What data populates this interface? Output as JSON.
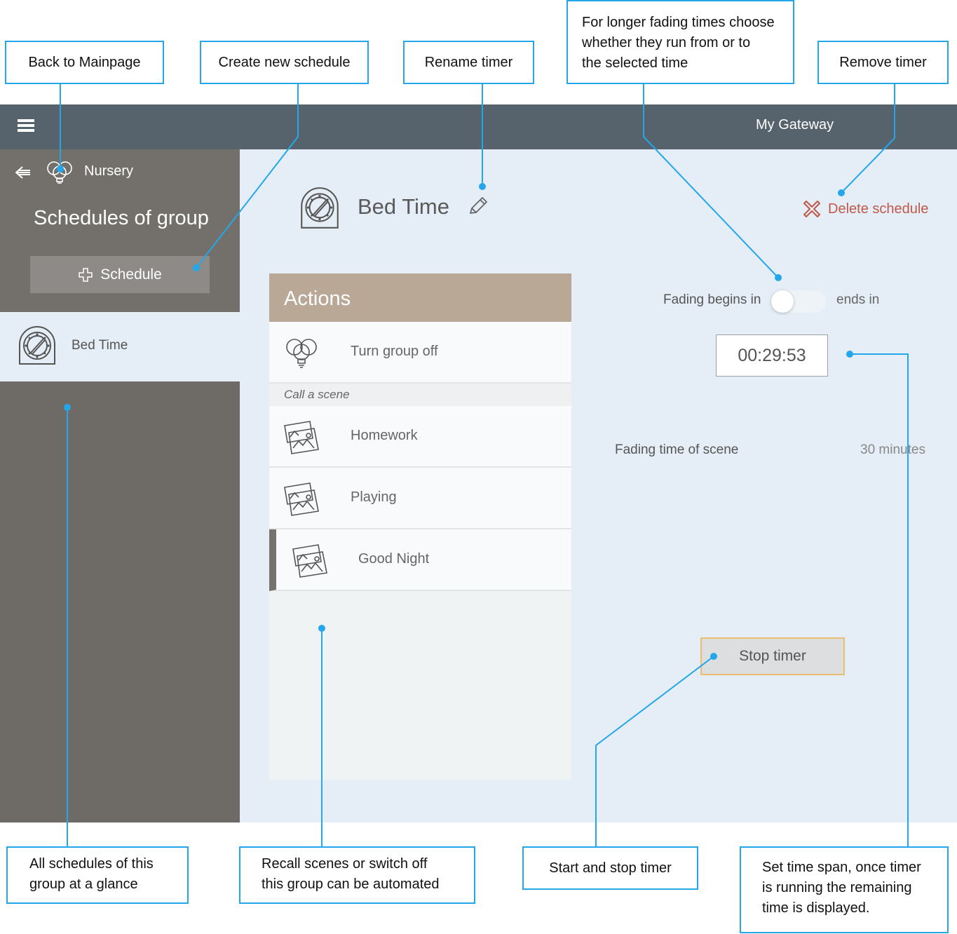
{
  "app": {
    "gateway_name": "My Gateway",
    "group_name": "Nursery",
    "sidebar_title": "Schedules of group",
    "add_schedule_label": "Schedule",
    "schedules": [
      {
        "label": "Bed Time"
      }
    ]
  },
  "timer": {
    "title": "Bed Time",
    "delete_label": "Delete schedule",
    "fading_begins_label": "Fading begins in",
    "fading_ends_label": "ends in",
    "time_value": "00:29:53",
    "fading_time_label": "Fading time of scene",
    "fading_time_value": "30 minutes",
    "stop_label": "Stop timer"
  },
  "actions": {
    "title": "Actions",
    "turn_off_label": "Turn group off",
    "scene_section_label": "Call a scene",
    "scenes": [
      {
        "label": "Homework"
      },
      {
        "label": "Playing"
      },
      {
        "label": "Good Night"
      }
    ]
  },
  "annotations": {
    "back_to_mainpage": "Back to Mainpage",
    "create_new_schedule": "Create new schedule",
    "rename_timer": "Rename timer",
    "fading_choice": [
      "For longer fading times choose",
      "whether they run from or to",
      "the selected time"
    ],
    "remove_timer": "Remove timer",
    "all_schedules": [
      "All schedules of this",
      "group at a glance"
    ],
    "recall_scenes": [
      "Recall scenes or switch off",
      "this group can be automated"
    ],
    "start_stop": "Start and stop timer",
    "set_time_span": [
      "Set time span, once timer",
      "is running the remaining",
      "time is displayed."
    ]
  },
  "colors": {
    "topbar": "#56636d",
    "sidebar": "#6e6a66",
    "main_bg": "#e5eef6",
    "actions_header": "#baa897",
    "delete_red": "#c0594a",
    "annotation_blue": "#23a7ea",
    "stop_border": "#e8c06c"
  },
  "icons": {
    "menu": "hamburger-icon",
    "back": "arrow-left-icon",
    "group": "bulbs-icon",
    "add": "plus-icon",
    "timer": "timer-dial-icon",
    "rename": "pencil-icon",
    "delete": "x-icon",
    "scene": "scene-pictures-icon"
  }
}
